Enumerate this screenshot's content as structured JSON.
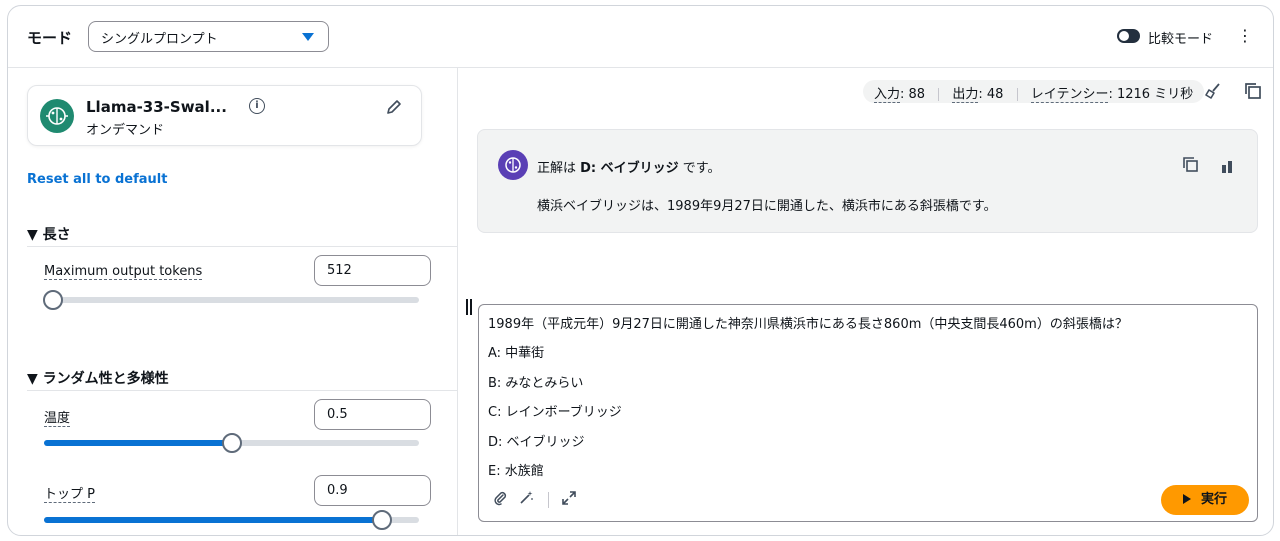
{
  "header": {
    "mode_label": "モード",
    "mode_select_value": "シングルプロンプト",
    "compare_label": "比較モード",
    "compare_enabled": false
  },
  "model": {
    "name": "Llama-33-Swal...",
    "subtitle": "オンデマンド"
  },
  "reset_label": "Reset all to default",
  "sections": {
    "length": {
      "title": "長さ",
      "max_tokens_label": "Maximum output tokens",
      "max_tokens_value": "512"
    },
    "randomness": {
      "title": "ランダム性と多様性",
      "temperature_label": "温度",
      "temperature_value": "0.5",
      "temperature_fraction": 0.5,
      "top_p_label": "トップ P",
      "top_p_value": "0.9",
      "top_p_fraction": 0.9
    }
  },
  "stats": {
    "input_label": "入力",
    "input_value": "88",
    "output_label": "出力",
    "output_value": "48",
    "latency_label": "レイテンシー",
    "latency_value": "1216 ミリ秒"
  },
  "response": {
    "line1_prefix": "正解は ",
    "line1_bold": "D: ベイブリッジ",
    "line1_suffix": " です。",
    "line2": "横浜ベイブリッジは、1989年9月27日に開通した、横浜市にある斜張橋です。"
  },
  "prompt": {
    "lines": [
      "1989年（平成元年）9月27日に開通した神奈川県横浜市にある長さ860m（中央支間長460m）の斜張橋は？",
      "A: 中華街",
      "B: みなとみらい",
      "C: レインボーブリッジ",
      "D: ベイブリッジ",
      "E: 水族館"
    ],
    "run_label": "実行"
  },
  "colors": {
    "accent": "#0972d3",
    "run_button": "#ff9900",
    "model_icon": "#1f8a70",
    "response_avatar": "#5a3fb5"
  }
}
